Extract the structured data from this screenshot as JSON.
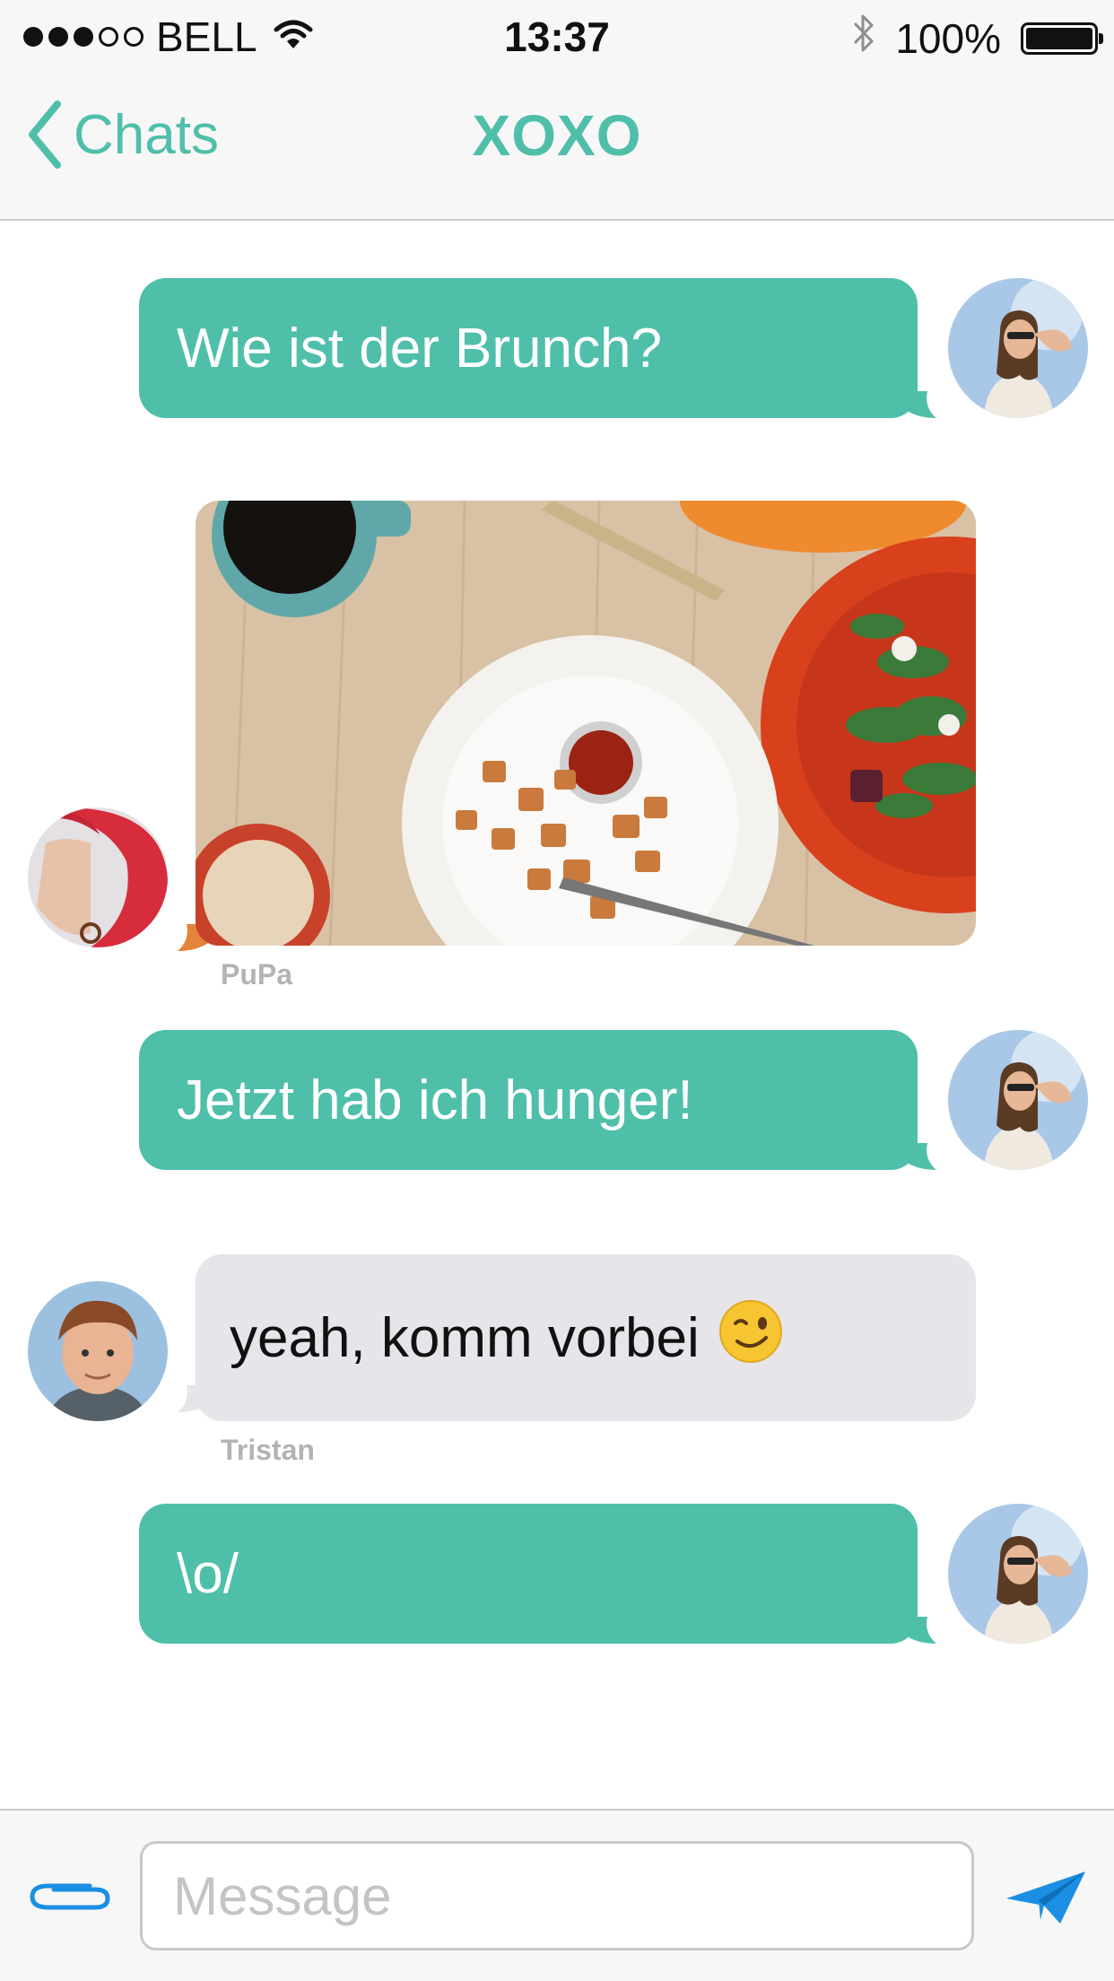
{
  "status_bar": {
    "carrier": "BELL",
    "time": "13:37",
    "battery": "100%",
    "signal_bars_filled": 3,
    "signal_bars_total": 5,
    "icons": [
      "wifi-icon",
      "bluetooth-icon",
      "battery-icon"
    ]
  },
  "nav": {
    "back_label": "Chats",
    "title": "XOXO"
  },
  "messages": [
    {
      "direction": "outgoing",
      "text": "Wie ist der Brunch?"
    },
    {
      "direction": "incoming",
      "type": "image",
      "sender": "PuPa"
    },
    {
      "direction": "outgoing",
      "text": "Jetzt hab ich hunger!"
    },
    {
      "direction": "incoming",
      "text": "yeah, komm vorbei",
      "emoji": "winking-face",
      "sender": "Tristan"
    },
    {
      "direction": "outgoing",
      "text": "\\o/"
    }
  ],
  "input": {
    "placeholder": "Message",
    "value": ""
  },
  "colors": {
    "accent": "#4fbfaa",
    "incoming_bubble": "#e5e5ea",
    "send_blue": "#1a8fe3"
  }
}
